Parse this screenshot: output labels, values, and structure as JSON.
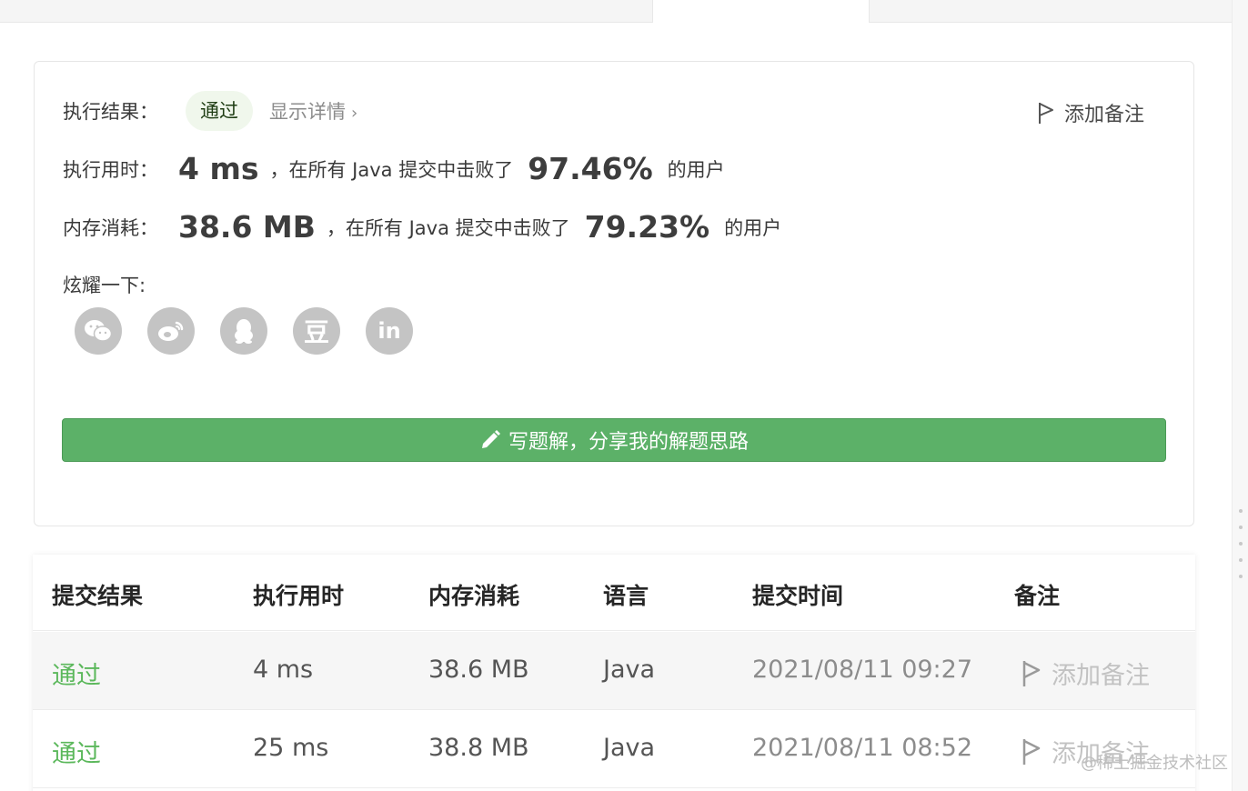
{
  "result": {
    "label_result": "执行结果：",
    "status": "通过",
    "detail_link": "显示详情",
    "add_note": "添加备注",
    "runtime": {
      "label": "执行用时：",
      "value": "4 ms",
      "text": "，在所有 Java 提交中击败了",
      "percent": "97.46%",
      "suffix": "的用户"
    },
    "memory": {
      "label": "内存消耗：",
      "value": "38.6 MB",
      "text": "，在所有 Java 提交中击败了",
      "percent": "79.23%",
      "suffix": "的用户"
    },
    "share_label": "炫耀一下:",
    "share_icons": [
      "wechat-icon",
      "weibo-icon",
      "qq-icon",
      "douban-icon",
      "linkedin-icon"
    ],
    "douban_glyph": "豆",
    "linkedin_glyph": "in",
    "write_solution": "写题解，分享我的解题思路"
  },
  "table": {
    "headers": [
      "提交结果",
      "执行用时",
      "内存消耗",
      "语言",
      "提交时间",
      "备注"
    ],
    "rows": [
      {
        "status": "通过",
        "runtime": "4 ms",
        "memory": "38.6 MB",
        "language": "Java",
        "time": "2021/08/11 09:27",
        "note": "添加备注"
      },
      {
        "status": "通过",
        "runtime": "25 ms",
        "memory": "38.8 MB",
        "language": "Java",
        "time": "2021/08/11 08:52",
        "note": "添加备注"
      }
    ]
  },
  "watermark": "@稀土掘金技术社区",
  "colors": {
    "pass_green": "#5cb85c",
    "cta_green": "#5cb168",
    "icon_gray": "#c4c4c4"
  }
}
